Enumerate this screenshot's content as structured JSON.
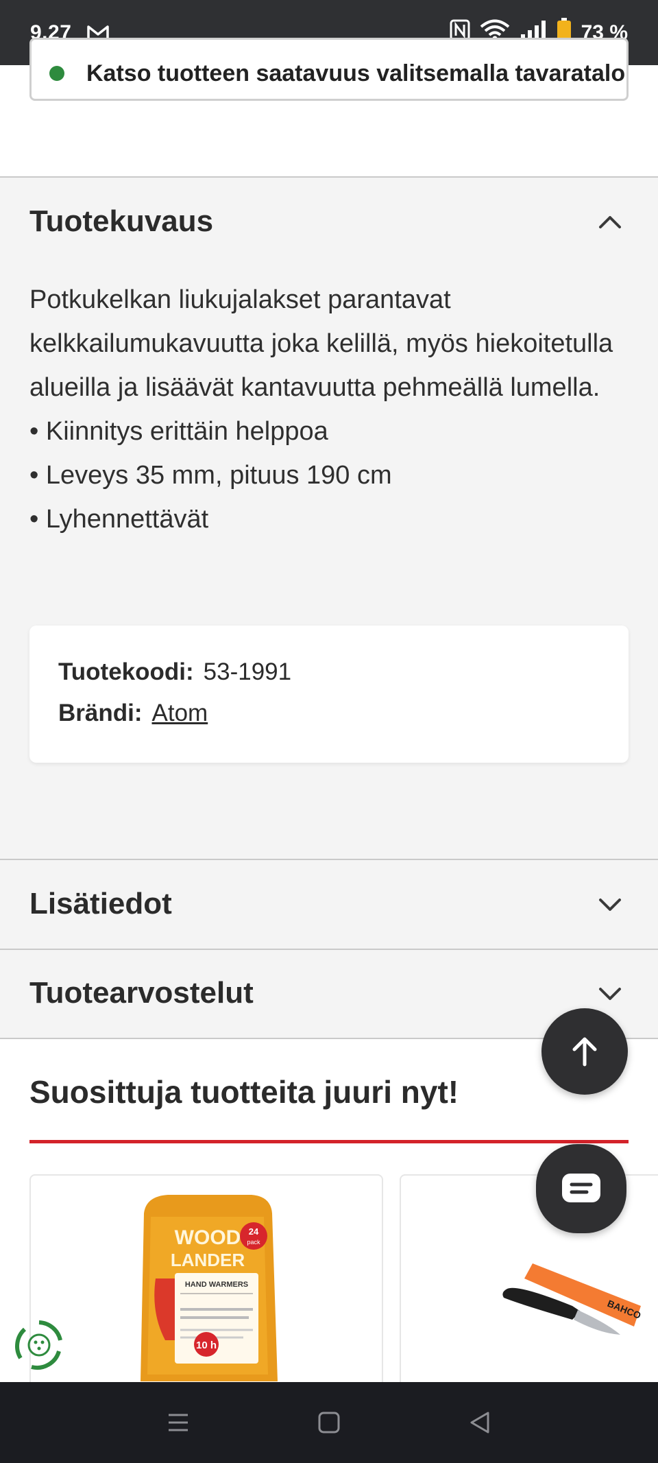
{
  "status_bar": {
    "time": "9.27",
    "battery": "73 %",
    "icons": [
      "gmail-icon",
      "nfc-icon",
      "wifi-icon",
      "signal-icon",
      "battery-icon"
    ]
  },
  "availability": {
    "text": "Katso tuotteen saatavuus valitsemalla tavaratalo"
  },
  "description_section": {
    "title": "Tuotekuvaus",
    "expanded": true,
    "paragraph": "Potkukelkan liukujalakset parantavat kelkkailumukavuutta joka kelillä, myös hiekoitetulla alueilla ja lisäävät kantavuutta pehmeällä lumella.",
    "bullets": [
      "• Kiinnitys erittäin helppoa",
      "• Leveys 35 mm, pituus 190 cm",
      "• Lyhennettävät"
    ],
    "product_code_label": "Tuotekoodi:",
    "product_code": "53-1991",
    "brand_label": "Brändi:",
    "brand": "Atom"
  },
  "more_info_section": {
    "title": "Lisätiedot",
    "expanded": false
  },
  "reviews_section": {
    "title": "Tuotearvostelut",
    "expanded": false
  },
  "popular": {
    "title": "Suosittuja tuotteita juuri nyt!",
    "products": [
      {
        "image": "hand-warmers-package",
        "brand_text": "WOOD LANDER",
        "pack": "24 pack",
        "badge": "10 h",
        "label": "HAND WARMERS"
      },
      {
        "image": "knife-with-sheath",
        "brand_text": "BAHCO"
      }
    ]
  },
  "colors": {
    "accent_red": "#d3232a",
    "dark": "#2f2f31",
    "status_green": "#2e8b3e"
  }
}
